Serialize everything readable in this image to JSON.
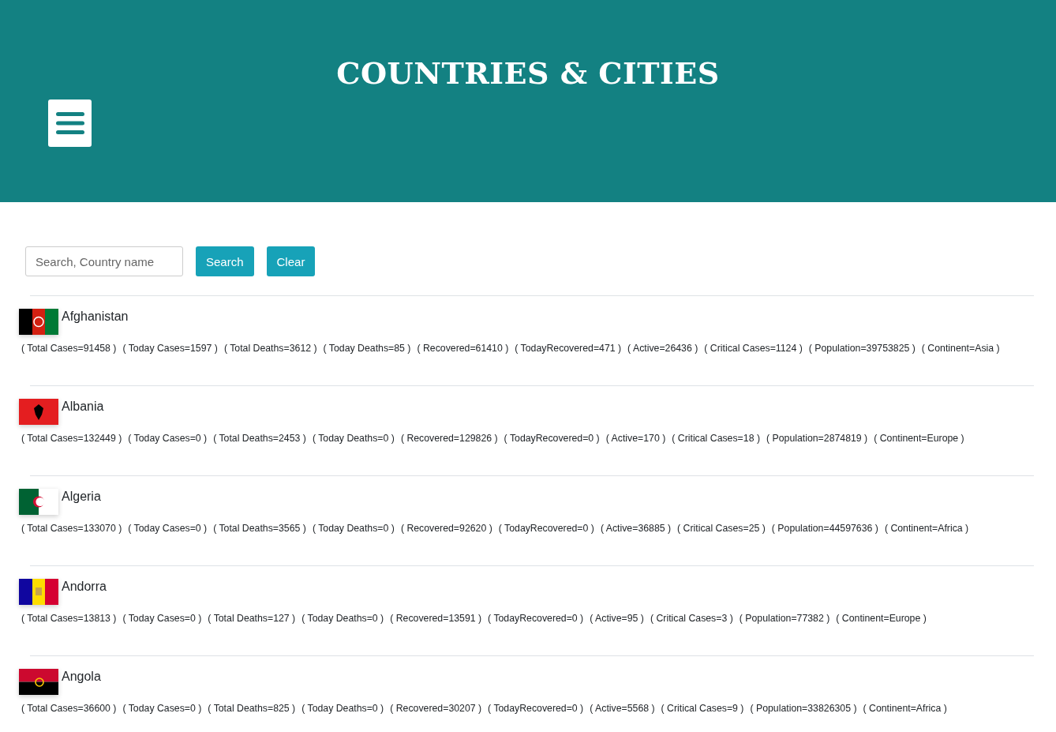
{
  "header": {
    "title": "COUNTRIES & CITIES"
  },
  "search": {
    "placeholder": "Search, Country name",
    "buttons": [
      "Search",
      "Clear"
    ]
  },
  "countries": [
    {
      "name": "Afghanistan",
      "kind": "af",
      "stats": [
        "( Total Cases=91458 )",
        "( Today Cases=1597 )",
        "( Total Deaths=3612 )",
        "( Today Deaths=85 )",
        "( Recovered=61410 )",
        "( TodayRecovered=471 )",
        "( Active=26436 )",
        "( Critical Cases=1124 )",
        "( Population=39753825 )",
        "( Continent=Asia )"
      ]
    },
    {
      "name": "Albania",
      "kind": "al",
      "stats": [
        "( Total Cases=132449 )",
        "( Today Cases=0 )",
        "( Total Deaths=2453 )",
        "( Today Deaths=0 )",
        "( Recovered=129826 )",
        "( TodayRecovered=0 )",
        "( Active=170 )",
        "( Critical Cases=18 )",
        "( Population=2874819 )",
        "( Continent=Europe )"
      ]
    },
    {
      "name": "Algeria",
      "kind": "dz",
      "stats": [
        "( Total Cases=133070 )",
        "( Today Cases=0 )",
        "( Total Deaths=3565 )",
        "( Today Deaths=0 )",
        "( Recovered=92620 )",
        "( TodayRecovered=0 )",
        "( Active=36885 )",
        "( Critical Cases=25 )",
        "( Population=44597636 )",
        "( Continent=Africa )"
      ]
    },
    {
      "name": "Andorra",
      "kind": "ad",
      "stats": [
        "( Total Cases=13813 )",
        "( Today Cases=0 )",
        "( Total Deaths=127 )",
        "( Today Deaths=0 )",
        "( Recovered=13591 )",
        "( TodayRecovered=0 )",
        "( Active=95 )",
        "( Critical Cases=3 )",
        "( Population=77382 )",
        "( Continent=Europe )"
      ]
    },
    {
      "name": "Angola",
      "kind": "ao",
      "stats": [
        "( Total Cases=36600 )",
        "( Today Cases=0 )",
        "( Total Deaths=825 )",
        "( Today Deaths=0 )",
        "( Recovered=30207 )",
        "( TodayRecovered=0 )",
        "( Active=5568 )",
        "( Critical Cases=9 )",
        "( Population=33826305 )",
        "( Continent=Africa )"
      ]
    }
  ]
}
